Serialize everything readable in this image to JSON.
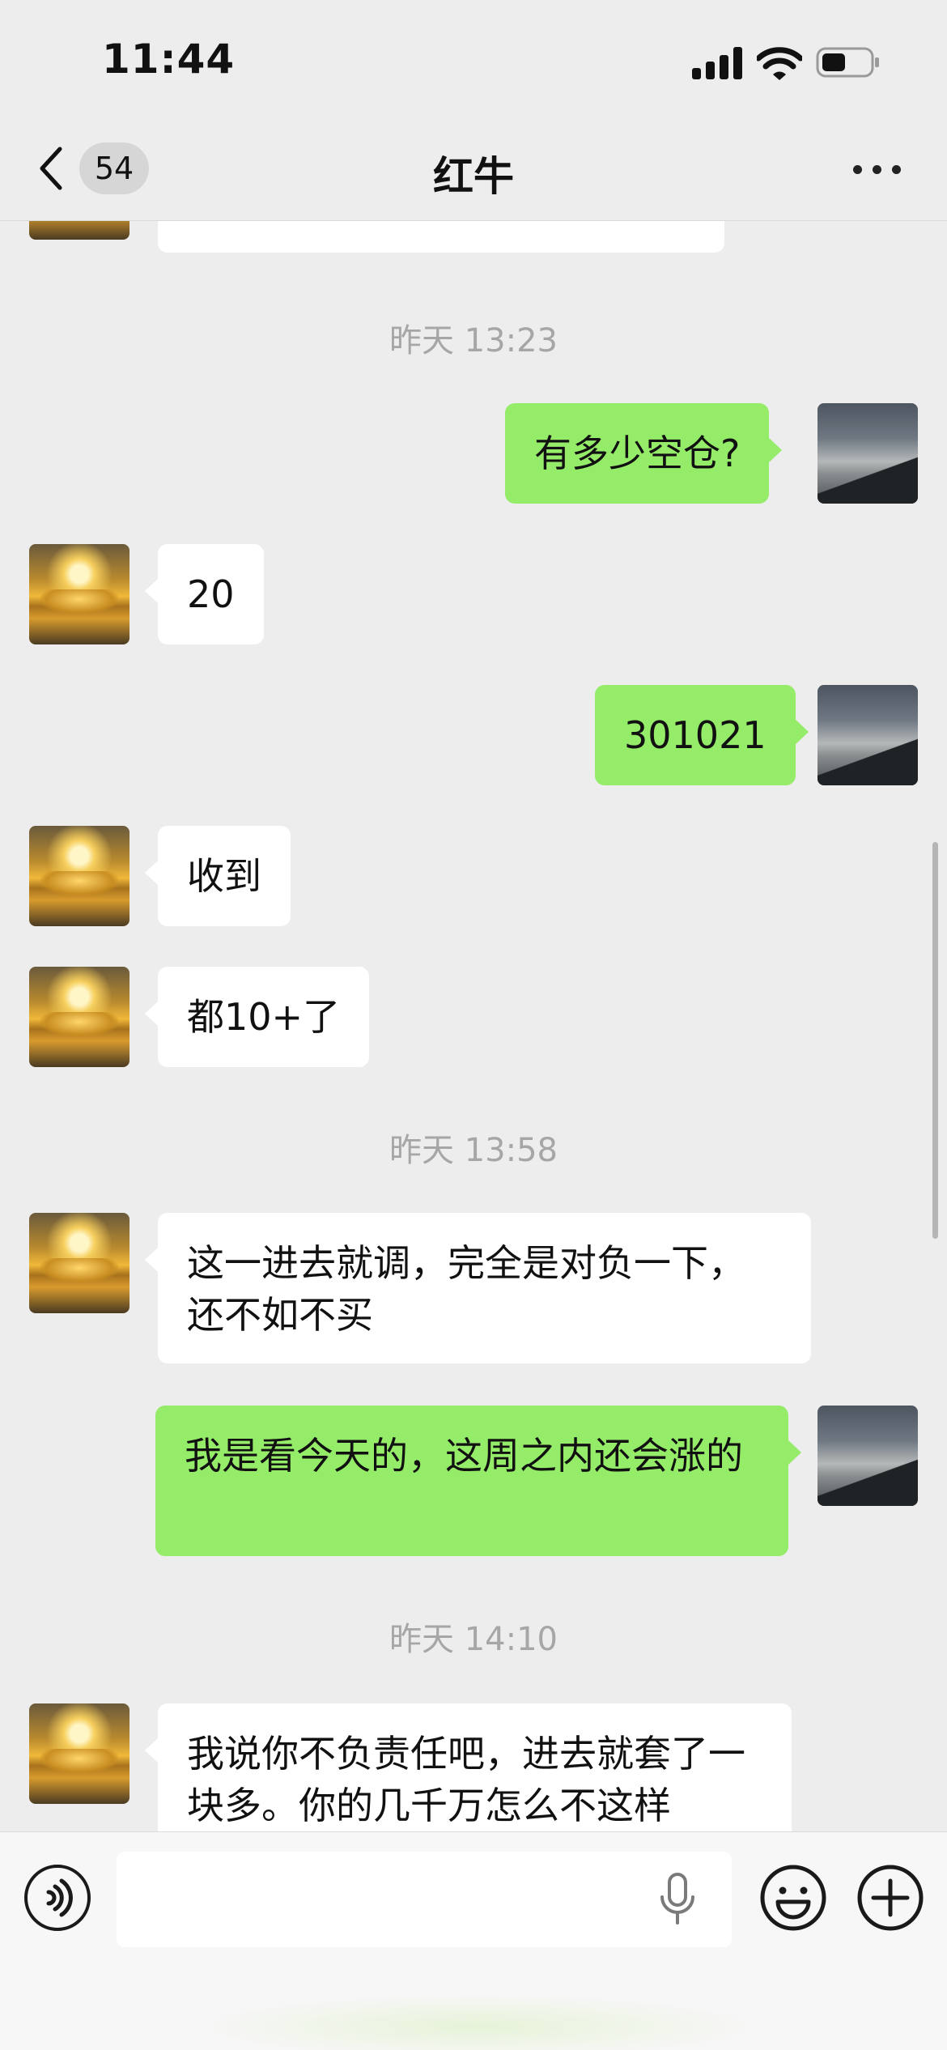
{
  "status_bar": {
    "time": "11:44"
  },
  "nav": {
    "back_count": "54",
    "title": "红牛"
  },
  "messages": [
    {
      "type": "partial_left",
      "text": ""
    },
    {
      "type": "time",
      "text": "昨天 13:23"
    },
    {
      "type": "right",
      "text": "有多少空仓?"
    },
    {
      "type": "left",
      "text": "20"
    },
    {
      "type": "right",
      "text": "301021"
    },
    {
      "type": "left",
      "text": "收到"
    },
    {
      "type": "left",
      "text": "都10+了"
    },
    {
      "type": "time",
      "text": "昨天 13:58"
    },
    {
      "type": "left",
      "text": "这一进去就调，完全是对负一下，还不如不买"
    },
    {
      "type": "right",
      "text": "我是看今天的，这周之内还会涨的"
    },
    {
      "type": "time",
      "text": "昨天 14:10"
    },
    {
      "type": "left",
      "text": "我说你不负责任吧，进去就套了一块多。你的几千万怎么不这样"
    }
  ],
  "input": {
    "value": "",
    "placeholder": ""
  },
  "icons": {
    "back": "chevron-left-icon",
    "more": "more-dots-icon",
    "voice": "voice-icon",
    "mic": "microphone-icon",
    "emoji": "emoji-icon",
    "plus": "plus-icon"
  },
  "colors": {
    "background": "#ededed",
    "sent_bubble": "#95ec69",
    "received_bubble": "#ffffff",
    "timestamp": "#a6a6a6"
  }
}
